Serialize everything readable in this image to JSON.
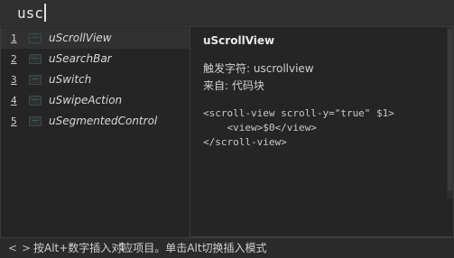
{
  "editor": {
    "typed_text": "usc"
  },
  "completion_list": {
    "items": [
      {
        "number": "1",
        "label": "uScrollView"
      },
      {
        "number": "2",
        "label": "uSearchBar"
      },
      {
        "number": "3",
        "label": "uSwitch"
      },
      {
        "number": "4",
        "label": "uSwipeAction"
      },
      {
        "number": "5",
        "label": "uSegmentedControl"
      }
    ],
    "selected_index": 0
  },
  "detail": {
    "title": "uScrollView",
    "trigger": "触发字符: uscrollview",
    "source": "来自: 代码块",
    "code": [
      "<scroll-view scroll-y=\"true\" $1>",
      "    <view>$0</view>",
      "</scroll-view>"
    ]
  },
  "status_bar": {
    "prev_icon": "chevron-left-icon",
    "next_icon": "chevron-right-icon",
    "hint": "按Alt+数字插入对应项目。单击Alt切换插入模式"
  },
  "colors": {
    "background": "#2b2b2b",
    "popup": "#252526",
    "selected_row": "#313131"
  }
}
